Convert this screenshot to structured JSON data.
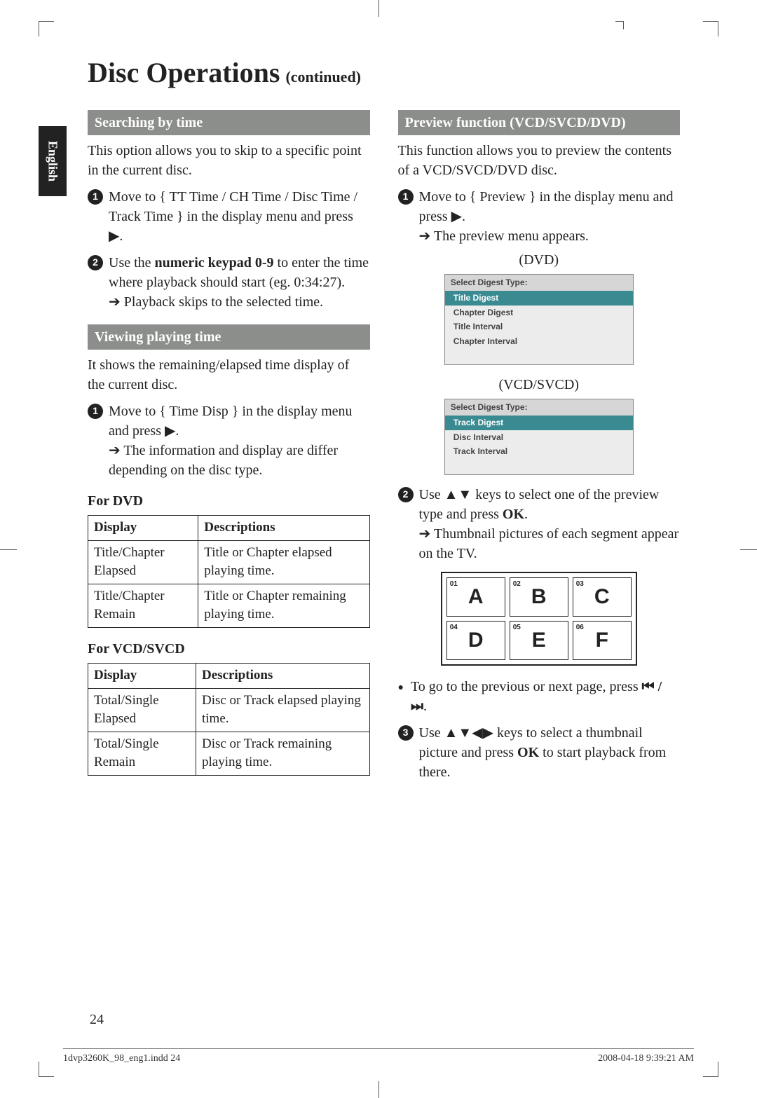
{
  "title": {
    "main": "Disc Operations",
    "sub": "(continued)"
  },
  "language_tab": "English",
  "left": {
    "search_hdr": "Searching by time",
    "search_intro": "This option allows you to skip to a specific point in the current disc.",
    "s1_body": "Move to { TT Time / CH Time / Disc Time / Track Time } in the display menu and press ▶.",
    "s2_pre": "Use the ",
    "s2_bold": "numeric keypad 0-9",
    "s2_post": " to enter the time where playback should start (eg. 0:34:27).",
    "s2_arrow": "Playback skips to the selected time.",
    "view_hdr": "Viewing playing time",
    "view_intro": "It shows the remaining/elapsed time display of the current disc.",
    "v1_body": "Move to { Time Disp } in the display menu and press ▶.",
    "v1_arrow": "The information and display are differ depending on the disc type.",
    "for_dvd": "For DVD",
    "for_vcd": "For VCD/SVCD",
    "th_display": "Display",
    "th_desc": "Descriptions",
    "dvd_rows": [
      {
        "d": "Title/Chapter Elapsed",
        "desc": "Title or Chapter elapsed playing time."
      },
      {
        "d": "Title/Chapter Remain",
        "desc": "Title or Chapter remaining playing time."
      }
    ],
    "vcd_rows": [
      {
        "d": "Total/Single Elapsed",
        "desc": "Disc or Track elapsed playing time."
      },
      {
        "d": "Total/Single Remain",
        "desc": "Disc or Track remaining playing time."
      }
    ]
  },
  "right": {
    "prev_hdr": "Preview function (VCD/SVCD/DVD)",
    "prev_intro": "This function allows you to preview the contents of a VCD/SVCD/DVD disc.",
    "p1_body": "Move to { Preview } in the display menu and press ▶.",
    "p1_arrow": "The preview menu appears.",
    "dvd_label": "(DVD)",
    "vcd_label": "(VCD/SVCD)",
    "menu_header": "Select Digest Type:",
    "dvd_menu": [
      "Title  Digest",
      "Chapter  Digest",
      "Title Interval",
      "Chapter Interval"
    ],
    "vcd_menu": [
      "Track  Digest",
      "Disc Interval",
      "Track Interval"
    ],
    "p2_pre": "Use ▲▼ keys to select one of the preview type and press ",
    "p2_bold": "OK",
    "p2_post": ".",
    "p2_arrow": "Thumbnail pictures of each segment appear on the TV.",
    "thumbs": [
      {
        "n": "01",
        "l": "A"
      },
      {
        "n": "02",
        "l": "B"
      },
      {
        "n": "03",
        "l": "C"
      },
      {
        "n": "04",
        "l": "D"
      },
      {
        "n": "05",
        "l": "E"
      },
      {
        "n": "06",
        "l": "F"
      }
    ],
    "bullet_pre": "To go to the previous or next page, press ",
    "bullet_sym": "⏮ / ⏭",
    "bullet_post": ".",
    "p3_pre": "Use ▲▼◀▶ keys to select a thumbnail picture and press ",
    "p3_bold": "OK",
    "p3_post": " to start playback from there."
  },
  "page_number": "24",
  "footer": {
    "left": "1dvp3260K_98_eng1.indd   24",
    "right": "2008-04-18   9:39:21 AM"
  }
}
